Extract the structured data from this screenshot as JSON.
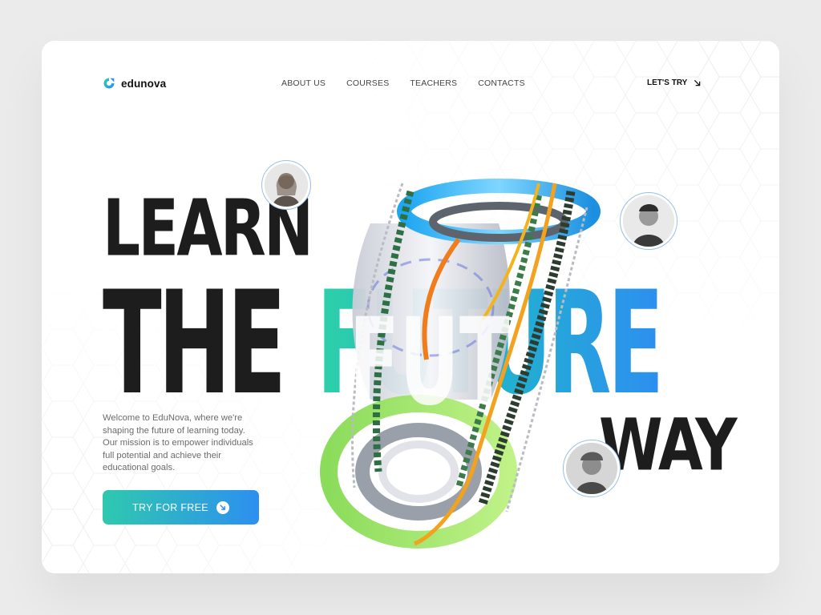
{
  "brand": {
    "name": "edunova",
    "logo_icon": "edunova-logo-icon",
    "accent_start": "#2ed0a8",
    "accent_end": "#2d8ff0"
  },
  "nav": {
    "items": [
      "ABOUT US",
      "COURSES",
      "TEACHERS",
      "CONTACTS"
    ]
  },
  "header_cta": {
    "label": "LET'S TRY",
    "icon": "arrow-down-right-icon"
  },
  "hero": {
    "line1": "LEARN",
    "line2a": "THE",
    "line2b": "FUTURE",
    "line3": "WAY",
    "intro": "Welcome to EduNova, where we're shaping the future of learning today. Our mission is to empower individuals full potential and achieve their educational goals.",
    "button_label": "TRY FOR FREE",
    "button_icon": "arrow-down-right-icon",
    "colors": {
      "text_dark": "#1d1d1d",
      "button_bg_start": "#2ec9ae",
      "button_bg_end": "#2d8ff0"
    }
  },
  "avatars": [
    "student-avatar-woman",
    "student-avatar-boy",
    "student-avatar-man"
  ]
}
